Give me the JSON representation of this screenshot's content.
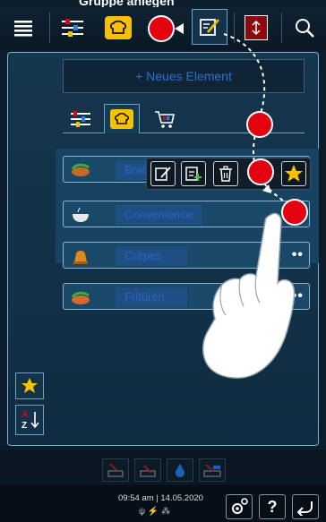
{
  "header": {
    "title": "Gruppe anlegen"
  },
  "toolbar": {
    "items": [
      {
        "name": "menu",
        "icon": "hamburger-icon"
      },
      {
        "name": "intelligent-cooking",
        "icon": "sliders-icon"
      },
      {
        "name": "programming",
        "icon": "chef-hat-icon"
      },
      {
        "name": "edit",
        "icon": "edit-icon"
      },
      {
        "name": "split",
        "icon": "split-icon"
      },
      {
        "name": "search",
        "icon": "search-icon"
      }
    ]
  },
  "new_element": {
    "label": "+ Neues Element"
  },
  "tabs": [
    {
      "name": "sliders",
      "icon": "sliders-icon"
    },
    {
      "name": "chef",
      "icon": "chef-hat-icon",
      "active": true
    },
    {
      "name": "basket",
      "icon": "basket-icon"
    }
  ],
  "list": [
    {
      "label": "Braten",
      "icon": "meat-icon"
    },
    {
      "label": "Convenience",
      "icon": "bowl-icon"
    },
    {
      "label": "Crêpes",
      "icon": "crepe-icon"
    },
    {
      "label": "Fritüren",
      "icon": "fish-icon"
    }
  ],
  "context_menu": [
    "edit-icon",
    "duplicate-icon",
    "delete-icon",
    "favorite-icon"
  ],
  "side": [
    "favorite-icon",
    "sort-az-icon"
  ],
  "status": {
    "time": "09:54 am",
    "date": "14.05.2020"
  },
  "footer": {
    "help_label": "?"
  },
  "colors": {
    "accent_yellow": "#f6c200",
    "red": "#e3000f",
    "panel_border": "#7fb0cc"
  }
}
